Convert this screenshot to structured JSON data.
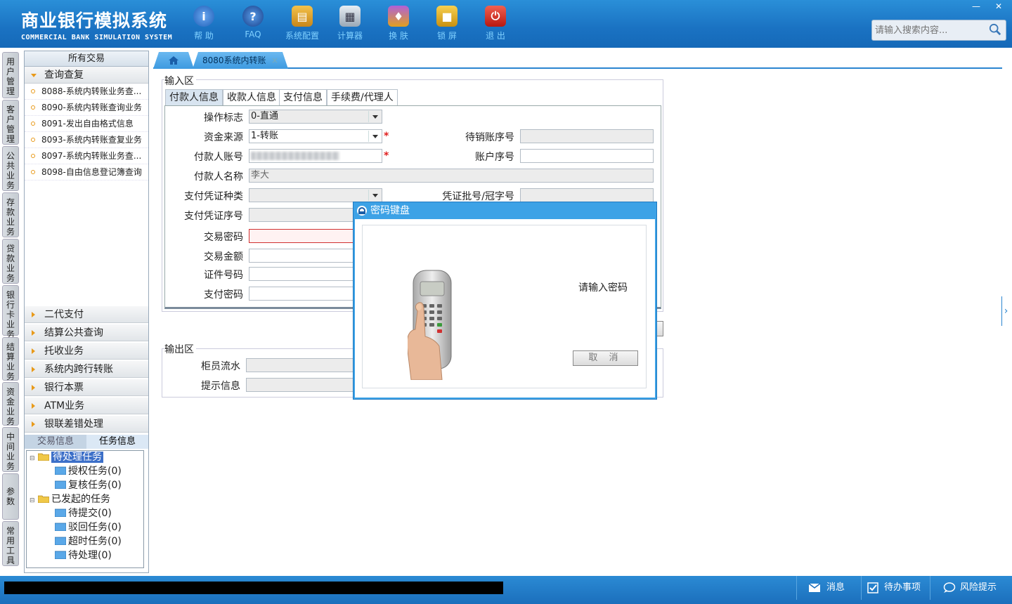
{
  "header": {
    "title_cn": "商业银行模拟系统",
    "title_en": "COMMERCIAL BANK SIMULATION SYSTEM",
    "tools": [
      {
        "label": "帮 助",
        "icon": "info-icon"
      },
      {
        "label": "FAQ",
        "icon": "question-icon"
      },
      {
        "label": "系统配置",
        "icon": "toolbox-icon"
      },
      {
        "label": "计算器",
        "icon": "calculator-icon"
      },
      {
        "label": "换 肤",
        "icon": "shirt-icon"
      },
      {
        "label": "锁 屏",
        "icon": "lock-icon"
      },
      {
        "label": "退 出",
        "icon": "power-icon"
      }
    ],
    "search_placeholder": "请输入搜索内容...",
    "win_minimize": "—",
    "win_close": "✕"
  },
  "vtabs": [
    "用户管理",
    "客户管理",
    "公共业务",
    "存款业务",
    "贷款业务",
    "银行卡业务",
    "结算业务",
    "资金业务",
    "中间业务",
    "参数",
    "常用工具"
  ],
  "nav": {
    "title": "所有交易",
    "open_group": "查询查复",
    "items": [
      "8088-系统内转账业务查...",
      "8090-系统内转账查询业务",
      "8091-发出自由格式信息",
      "8093-系统内转账查复业务",
      "8097-系统内转账业务查...",
      "8098-自由信息登记簿查询"
    ],
    "groups": [
      "二代支付",
      "结算公共查询",
      "托收业务",
      "系统内跨行转账",
      "银行本票",
      "ATM业务",
      "银联差错处理"
    ],
    "bottom_tabs": [
      "交易信息",
      "任务信息"
    ],
    "tree": {
      "pending": "待处理任务",
      "auth": "授权任务(0)",
      "review": "复核任务(0)",
      "initiated": "已发起的任务",
      "to_submit": "待提交(0)",
      "rejected": "驳回任务(0)",
      "timeout": "超时任务(0)",
      "to_process": "待处理(0)"
    }
  },
  "tabs": {
    "home_icon": "home-icon",
    "active": "8080系统内转账",
    "close": "×"
  },
  "form": {
    "input_area": "输入区",
    "subtabs": [
      "付款人信息",
      "收款人信息",
      "支付信息",
      "手续费/代理人"
    ],
    "labels": {
      "op_flag": "操作标志",
      "fund_source": "资金来源",
      "payer_account": "付款人账号",
      "payer_name": "付款人名称",
      "voucher_type": "支付凭证种类",
      "voucher_no": "支付凭证序号",
      "trade_pwd": "交易密码",
      "amount": "交易金额",
      "id_no": "证件号码",
      "pay_pwd": "支付密码",
      "pending_seq": "待销账序号",
      "account_seq": "账户序号",
      "voucher_batch": "凭证批号/冠字号"
    },
    "values": {
      "op_flag": "0-直通",
      "fund_source": "1-转账",
      "payer_name": "李大"
    },
    "required_mark": "*",
    "output_area": "输出区",
    "teller_flow": "柜员流水",
    "prompt_info": "提示信息"
  },
  "dialog": {
    "title": "密码键盘",
    "message": "请输入密码",
    "cancel": "取 消"
  },
  "status": {
    "messages": "消息",
    "todo": "待办事项",
    "risk": "风险提示"
  }
}
